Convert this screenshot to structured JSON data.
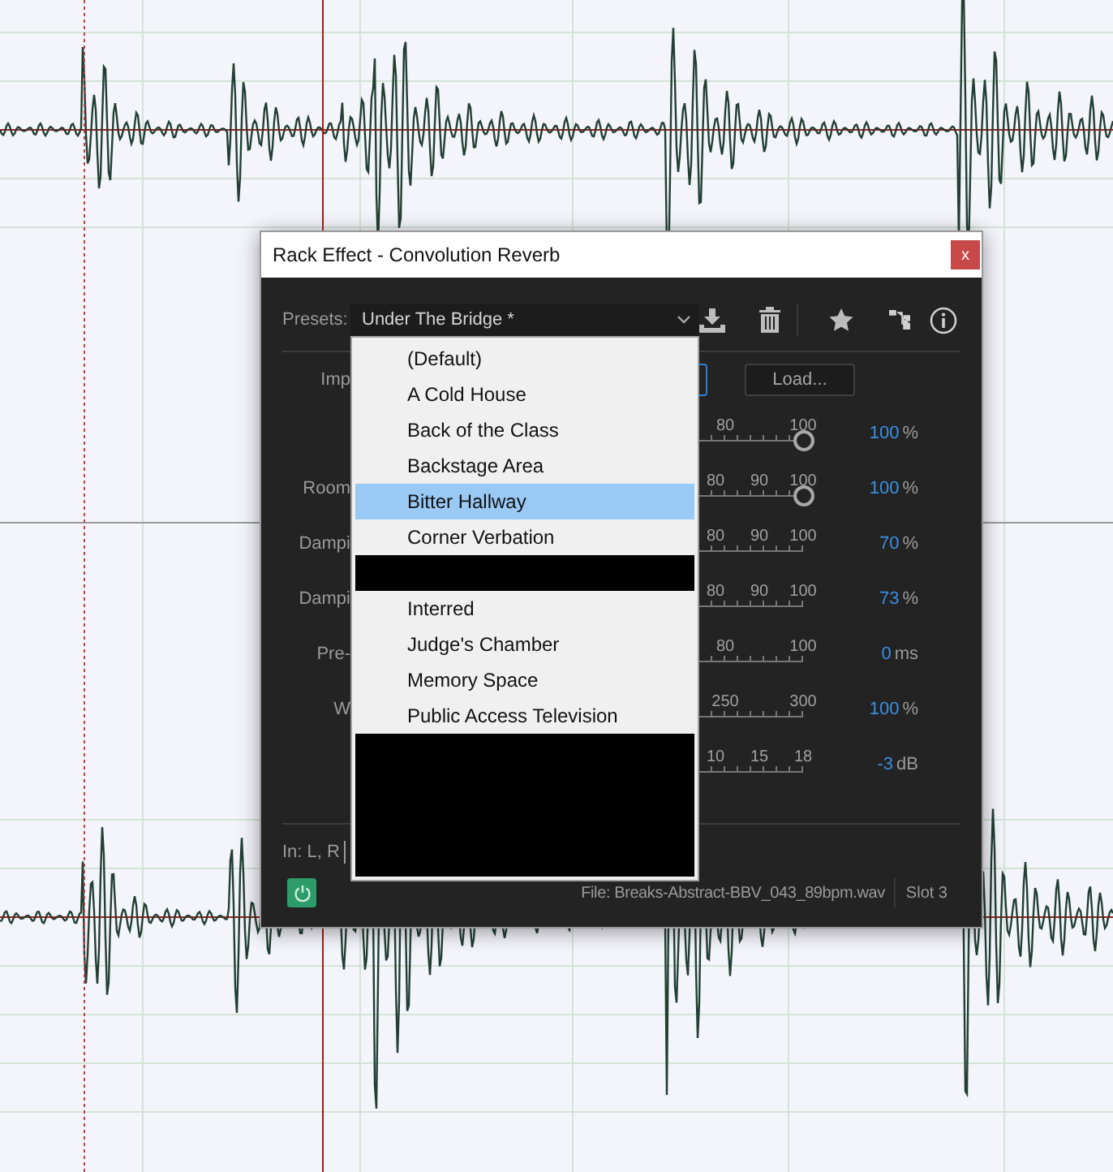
{
  "window": {
    "title": "Rack Effect - Convolution Reverb",
    "close": "x"
  },
  "presets": {
    "label": "Presets:",
    "value": "Under The Bridge *"
  },
  "impulse": {
    "label": "Imp",
    "button": "Load..."
  },
  "parameters": [
    {
      "ticks": [
        "80",
        "100"
      ],
      "level": 1,
      "value": "100",
      "unit": "%"
    },
    {
      "label": "Room",
      "ticks": [
        "80",
        "90",
        "100"
      ],
      "level": 1,
      "value": "100",
      "unit": "%"
    },
    {
      "label": "Dampi",
      "ticks": [
        "80",
        "90",
        "100"
      ],
      "value": "70",
      "unit": "%"
    },
    {
      "label": "Dampi",
      "ticks": [
        "80",
        "90",
        "100"
      ],
      "value": "73",
      "unit": "%"
    },
    {
      "label": "Pre-",
      "ticks": [
        "80",
        "100"
      ],
      "value": "0",
      "unit": "ms"
    },
    {
      "label": "W",
      "ticks": [
        "250",
        "300"
      ],
      "value": "100",
      "unit": "%"
    },
    {
      "ticks": [
        "10",
        "15",
        "18"
      ],
      "value": "-3",
      "unit": "dB"
    }
  ],
  "footer": {
    "channels": "In: L, R",
    "power_on": true,
    "file": "File: Breaks-Abstract-BBV_043_89bpm.wav",
    "slot": "Slot 3"
  },
  "preset_menu": [
    {
      "kind": "item",
      "label": "(Default)",
      "selected": false
    },
    {
      "kind": "item",
      "label": "A Cold House",
      "selected": false
    },
    {
      "kind": "item",
      "label": "Back of the Class",
      "selected": false
    },
    {
      "kind": "item",
      "label": "Backstage Area",
      "selected": false
    },
    {
      "kind": "item",
      "label": "Bitter Hallway",
      "selected": true
    },
    {
      "kind": "item",
      "label": "Corner Verbation",
      "selected": false
    },
    {
      "kind": "redacted"
    },
    {
      "kind": "item",
      "label": "Interred",
      "selected": false
    },
    {
      "kind": "item",
      "label": "Judge's Chamber",
      "selected": false
    },
    {
      "kind": "item",
      "label": "Memory Space",
      "selected": false
    },
    {
      "kind": "item",
      "label": "Public Access Television",
      "selected": false
    },
    {
      "kind": "redacted"
    },
    {
      "kind": "redacted"
    },
    {
      "kind": "redacted"
    },
    {
      "kind": "redacted"
    }
  ]
}
